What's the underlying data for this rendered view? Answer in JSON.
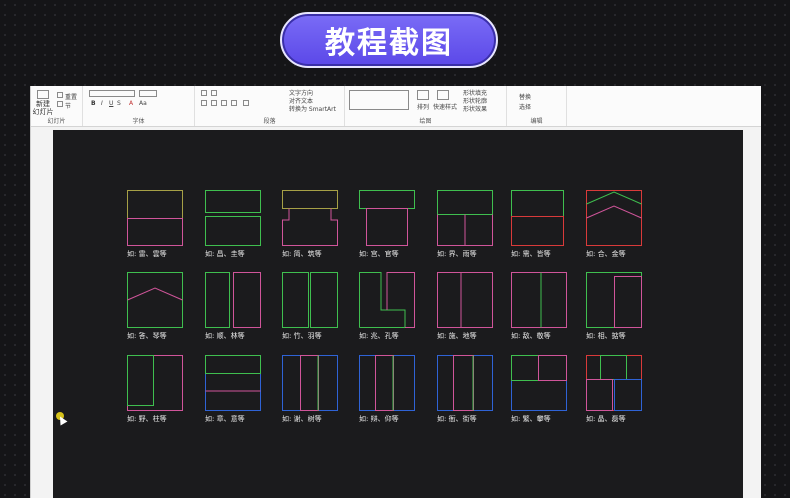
{
  "banner": {
    "title": "教程截图"
  },
  "ribbon": {
    "new_slide": "新建\n幻灯片",
    "reset": "重置",
    "section": "节",
    "group_slides": "幻灯片",
    "group_font": "字体",
    "group_paragraph": "段落",
    "group_drawing": "绘图",
    "group_editing": "编辑",
    "text_direction": "文字方向",
    "align_text": "对齐文本",
    "convert_smartart": "转换为 SmartArt",
    "arrange": "排列",
    "quick_styles": "快速样式",
    "shape_fill": "形状填充",
    "shape_outline": "形状轮廓",
    "shape_effects": "形状效果",
    "replace": "替换",
    "select": "选择"
  },
  "glyphs": [
    {
      "caption": "如: 雷、雲等"
    },
    {
      "caption": "如: 昌、圭等"
    },
    {
      "caption": "如: 简、筑等"
    },
    {
      "caption": "如: 宫、官等"
    },
    {
      "caption": "如: 界、雨等"
    },
    {
      "caption": "如: 需、皆等"
    },
    {
      "caption": "如: 合、金等"
    },
    {
      "caption": "如: 答、琴等"
    },
    {
      "caption": "如: 顺、林等"
    },
    {
      "caption": "如: 竹、羽等"
    },
    {
      "caption": "如: 兆、孔等"
    },
    {
      "caption": "如: 施、地等"
    },
    {
      "caption": "如: 敌、敬等"
    },
    {
      "caption": "如: 相、掂等"
    },
    {
      "caption": "如: 野、柱等"
    },
    {
      "caption": "如: 章、意等"
    },
    {
      "caption": "如: 谢、树等"
    },
    {
      "caption": "如: 辩、仰等"
    },
    {
      "caption": "如: 衙、街等"
    },
    {
      "caption": "如: 繁、攀等"
    },
    {
      "caption": "如: 晶、磊等"
    }
  ],
  "colors": {
    "green": "#3fbf4f",
    "pink": "#d0559a",
    "blue": "#2f63d6",
    "red": "#d93a3a",
    "olive": "#a6a046",
    "banner": "#6a5af0"
  }
}
